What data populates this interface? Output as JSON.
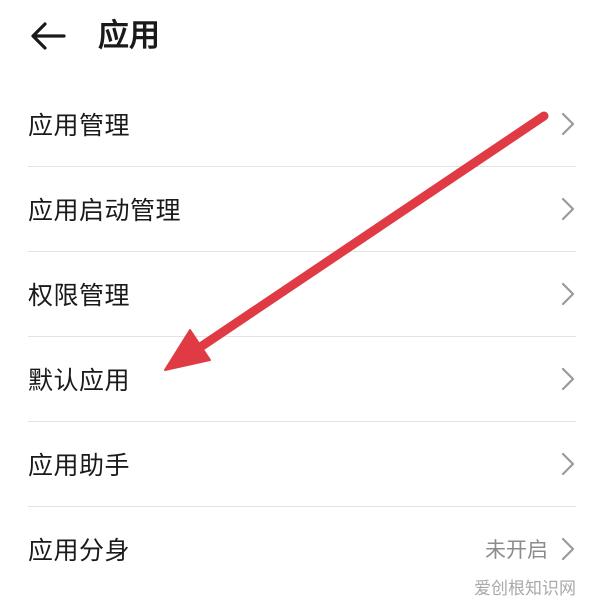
{
  "header": {
    "title": "应用",
    "back_icon": "arrow-left-icon"
  },
  "menu": {
    "items": [
      {
        "label": "应用管理",
        "value": ""
      },
      {
        "label": "应用启动管理",
        "value": ""
      },
      {
        "label": "权限管理",
        "value": ""
      },
      {
        "label": "默认应用",
        "value": ""
      },
      {
        "label": "应用助手",
        "value": ""
      },
      {
        "label": "应用分身",
        "value": "未开启"
      }
    ],
    "chevron_icon": "chevron-right-icon"
  },
  "annotation": {
    "color": "#e03a45",
    "target": "默认应用"
  },
  "watermark": "爱创根知识网"
}
